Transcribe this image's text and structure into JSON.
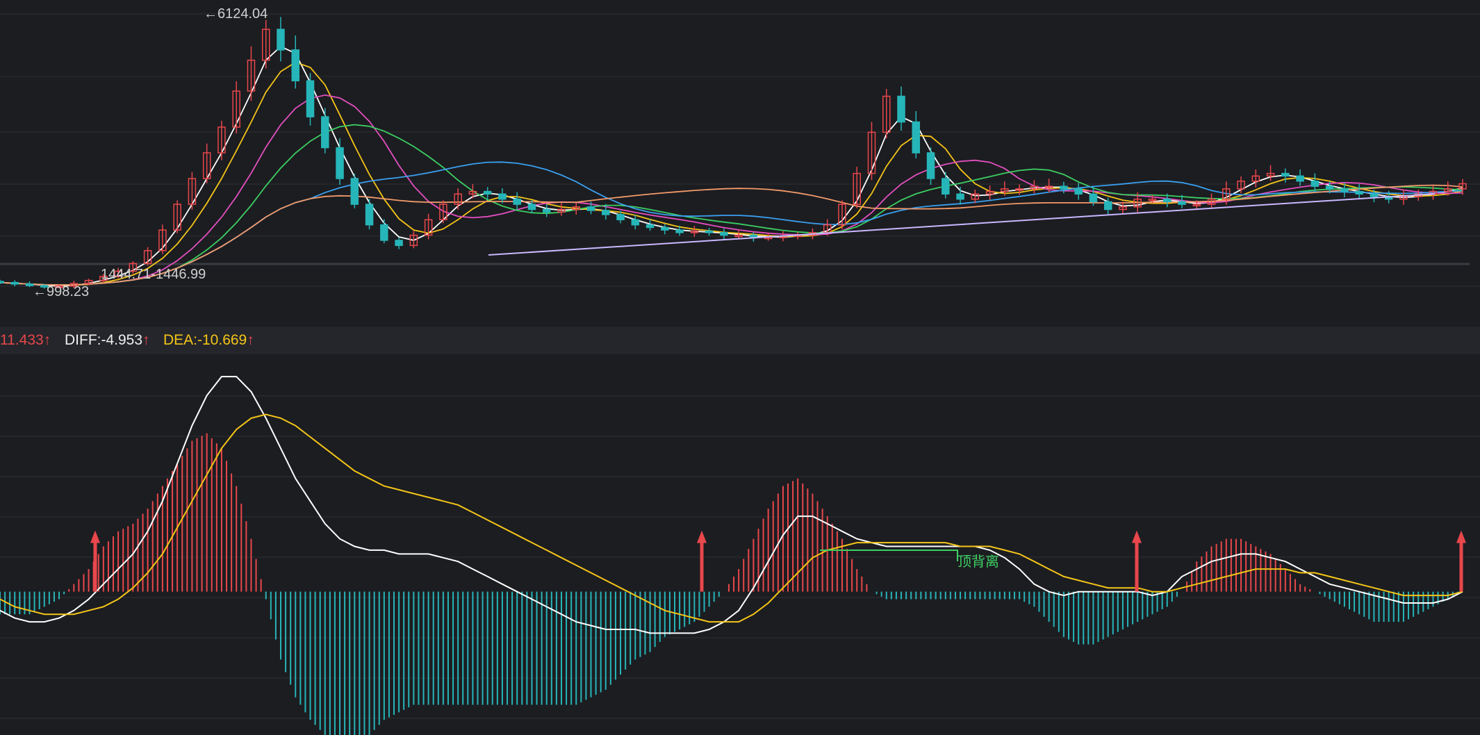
{
  "price_panel": {
    "high_label": "←6124.04",
    "low_label": "←998.23",
    "range_label": "1444.71-1446.99"
  },
  "macd_header": {
    "macd_text": "11.433",
    "diff_text": "DIFF:-4.953",
    "dea_text": "DEA:-10.669",
    "arrow": "↑"
  },
  "annotation": {
    "divergence_text": "顶背离"
  },
  "colors": {
    "background": "#1c1d21",
    "up": "#e8474b",
    "down": "#26b5b8",
    "diff": "#ffffff",
    "dea": "#f5c518",
    "ma5": "#ffffff",
    "ma10": "#f5c518",
    "ma20": "#e44fc0",
    "ma30": "#3ccf62",
    "ma60": "#3aa0f0",
    "ma120": "#f39a6a",
    "trendline": "#c9b8ff",
    "divergence": "#3ccf62"
  },
  "chart_data": [
    {
      "type": "candlestick",
      "title": "",
      "ylim": [
        900,
        6300
      ],
      "annotations": [
        "←6124.04",
        "←998.23",
        "1444.71-1446.99"
      ],
      "series": [
        {
          "name": "close",
          "values": [
            1080,
            1050,
            1020,
            1000,
            1010,
            1060,
            1120,
            1200,
            1300,
            1450,
            1700,
            2100,
            2600,
            3100,
            3600,
            4100,
            4800,
            5400,
            6000,
            5600,
            5000,
            4300,
            3700,
            3100,
            2600,
            2200,
            1900,
            1800,
            2000,
            2300,
            2600,
            2800,
            2850,
            2800,
            2700,
            2600,
            2500,
            2450,
            2500,
            2550,
            2480,
            2400,
            2300,
            2200,
            2150,
            2100,
            2050,
            2080,
            2050,
            2000,
            2000,
            1950,
            1960,
            1980,
            2000,
            2050,
            2200,
            2600,
            3200,
            4000,
            4700,
            4200,
            3600,
            3100,
            2800,
            2700,
            2800,
            2850,
            2900,
            2900,
            2950,
            2950,
            2900,
            2800,
            2650,
            2500,
            2550,
            2700,
            2700,
            2650,
            2600,
            2600,
            2700,
            2900,
            3050,
            3150,
            3200,
            3150,
            3050,
            2950,
            2900,
            2850,
            2800,
            2750,
            2700,
            2750,
            2800,
            2850,
            2900,
            3000
          ]
        }
      ]
    },
    {
      "type": "bar",
      "title": "",
      "ylim": [
        -38,
        62
      ],
      "series": [
        {
          "name": "DIFF",
          "values": [
            -5,
            -7,
            -8,
            -8,
            -7,
            -5,
            -2,
            2,
            6,
            10,
            16,
            24,
            34,
            44,
            52,
            57,
            57,
            53,
            46,
            38,
            30,
            24,
            18,
            14,
            12,
            11,
            11,
            10,
            10,
            10,
            9,
            8,
            6,
            4,
            2,
            0,
            -2,
            -4,
            -6,
            -8,
            -9,
            -10,
            -10,
            -10,
            -11,
            -11,
            -11,
            -11,
            -10,
            -8,
            -5,
            1,
            8,
            15,
            20,
            20,
            18,
            16,
            14,
            13,
            12,
            12,
            12,
            12,
            12,
            12,
            12,
            11,
            9,
            6,
            2,
            0,
            -1,
            0,
            0,
            0,
            0,
            0,
            -1,
            0,
            4,
            6,
            8,
            9,
            10,
            10,
            9,
            8,
            6,
            4,
            2,
            1,
            0,
            -1,
            -2,
            -3,
            -3,
            -3,
            -2,
            0
          ]
        },
        {
          "name": "DEA",
          "values": [
            -2,
            -4,
            -5,
            -6,
            -6,
            -6,
            -5,
            -4,
            -2,
            1,
            5,
            10,
            17,
            24,
            31,
            38,
            43,
            46,
            47,
            46,
            44,
            41,
            38,
            35,
            32,
            30,
            28,
            27,
            26,
            25,
            24,
            23,
            21,
            19,
            17,
            15,
            13,
            11,
            9,
            7,
            5,
            3,
            1,
            -1,
            -3,
            -5,
            -6,
            -7,
            -8,
            -8,
            -8,
            -6,
            -3,
            1,
            5,
            9,
            11,
            12,
            13,
            13,
            13,
            13,
            13,
            13,
            13,
            12,
            12,
            12,
            11,
            10,
            8,
            6,
            4,
            3,
            2,
            1,
            1,
            1,
            0,
            0,
            1,
            2,
            3,
            4,
            5,
            6,
            6,
            6,
            5,
            5,
            4,
            3,
            2,
            1,
            0,
            -1,
            -1,
            -1,
            -1,
            0
          ]
        },
        {
          "name": "MACD",
          "values": [
            -6,
            -6,
            -6,
            -4,
            -2,
            2,
            6,
            12,
            16,
            18,
            22,
            28,
            34,
            40,
            42,
            38,
            28,
            14,
            -2,
            -18,
            -28,
            -34,
            -38,
            -40,
            -40,
            -38,
            -34,
            -32,
            -30,
            -30,
            -30,
            -30,
            -30,
            -30,
            -30,
            -30,
            -30,
            -30,
            -30,
            -30,
            -28,
            -26,
            -22,
            -18,
            -16,
            -12,
            -10,
            -8,
            -4,
            0,
            6,
            14,
            22,
            28,
            30,
            26,
            20,
            14,
            6,
            0,
            -2,
            -2,
            -2,
            -2,
            -2,
            -2,
            -2,
            -2,
            -2,
            -2,
            -4,
            -8,
            -12,
            -14,
            -14,
            -12,
            -10,
            -8,
            -6,
            -4,
            0,
            8,
            12,
            14,
            14,
            12,
            10,
            6,
            2,
            0,
            -2,
            -4,
            -6,
            -8,
            -8,
            -8,
            -6,
            -4,
            -2,
            0
          ]
        }
      ]
    }
  ]
}
